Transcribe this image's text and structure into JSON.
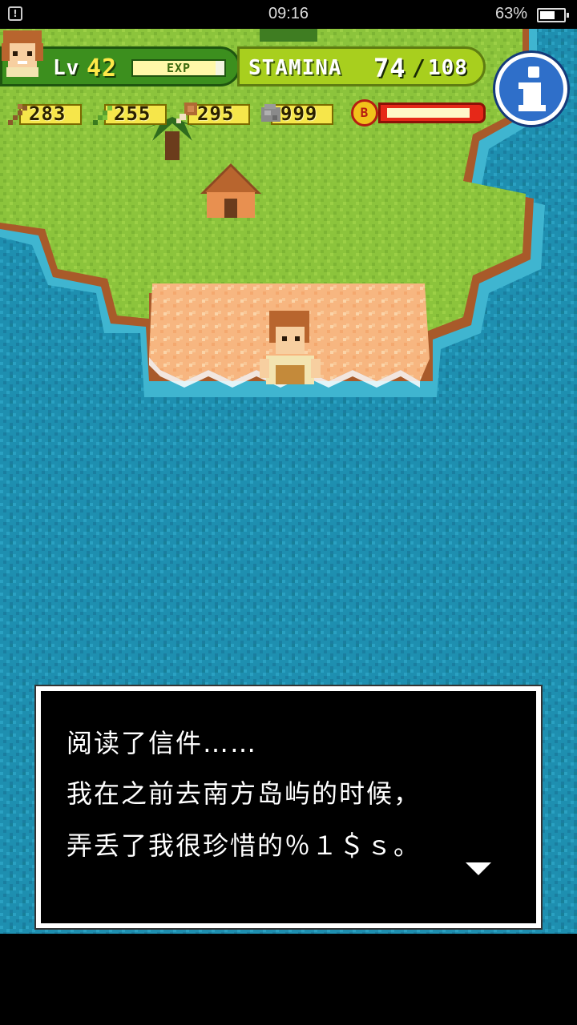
{
  "status_bar": {
    "notification_icon": "warning-icon",
    "time": "09:16",
    "battery_percent": "63%",
    "battery_level": 0.63
  },
  "hud": {
    "level_label": "Lv",
    "level": "42",
    "exp_label": "EXP",
    "exp_fraction": 0.9,
    "stamina_label": "STAMINA",
    "stamina_current": "74",
    "stamina_separator": "/",
    "stamina_max": "108",
    "resources": [
      {
        "icon": "branch-icon",
        "value": "283"
      },
      {
        "icon": "leaf-icon",
        "value": "255"
      },
      {
        "icon": "meat-icon",
        "value": "295"
      },
      {
        "icon": "stone-icon",
        "value": "999"
      }
    ],
    "buff_label": "B",
    "buff_fraction": 0.92,
    "info_icon": "info-icon"
  },
  "dialog": {
    "lines": [
      "阅读了信件……",
      "我在之前去南方岛屿的时候，",
      "弄丢了我很珍惜的％１＄ｓ。"
    ],
    "continue_icon": "down-arrow-icon"
  },
  "colors": {
    "sea": "#1e8fb0",
    "grass": "#8cc43c",
    "sand": "#f7b680",
    "hud_green": "#3c8f1e",
    "stamina_green": "#a8cf1e",
    "resource_yellow": "#f6e64a"
  }
}
